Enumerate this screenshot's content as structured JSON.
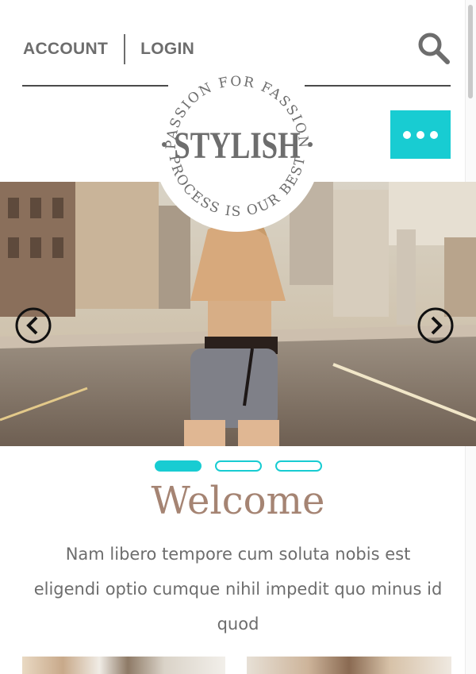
{
  "header": {
    "account_label": "ACCOUNT",
    "login_label": "LOGIN",
    "search_icon": "search-icon",
    "menu_icon": "ellipsis-icon"
  },
  "logo": {
    "name": "STYLISH",
    "arc_top": "PASSION FOR FASSION",
    "arc_bottom": "PROCESS IS OUR BEST"
  },
  "slider": {
    "prev_icon": "chevron-left-icon",
    "next_icon": "chevron-right-icon",
    "slide_count": 3,
    "active_slide": 1
  },
  "content": {
    "heading": "Welcome",
    "intro": "Nam libero tempore cum soluta nobis est eligendi optio cumque nihil impedit quo minus id quod"
  },
  "colors": {
    "accent": "#18ccd2",
    "text": "#6d6d6d",
    "heading": "#a58473",
    "rule": "#4a4a4a"
  }
}
